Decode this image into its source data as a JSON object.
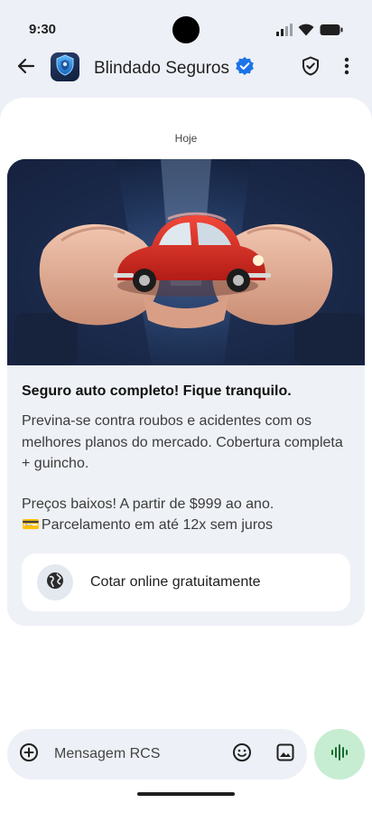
{
  "status_bar": {
    "time": "9:30",
    "icons": [
      "signal-icon",
      "wifi-icon",
      "battery-icon"
    ]
  },
  "app_bar": {
    "title": "Blindado Seguros",
    "verified": true,
    "icons": [
      "back-arrow-icon",
      "shield-logo-icon",
      "verified-badge-icon",
      "shield-check-icon",
      "more-vert-icon"
    ]
  },
  "conversation": {
    "date_label": "Hoje",
    "card": {
      "image_description_icon": "car-in-hands-image",
      "title": "Seguro auto completo! Fique tranquilo.",
      "description": "Previna-se contra roubos e acidentes com os melhores planos do mercado. Cobertura completa + guincho.",
      "price_line": "Preços baixos! A partir de $999 ao ano.",
      "installment_emoji": "💳",
      "installment_text": "Parcelamento em até 12x sem juros",
      "suggestion": {
        "icon": "globe-icon",
        "label": "Cotar online gratuitamente"
      }
    }
  },
  "compose": {
    "placeholder": "Mensagem RCS",
    "icons": [
      "add-circle-icon",
      "emoji-icon",
      "gallery-icon",
      "voice-waveform-icon"
    ]
  },
  "colors": {
    "background": "#edf0f6",
    "surface": "#ffffff",
    "card": "#eef1f6",
    "verified_blue": "#1a73e8",
    "voice_button": "#c6edd1",
    "voice_icon": "#146c2e"
  }
}
